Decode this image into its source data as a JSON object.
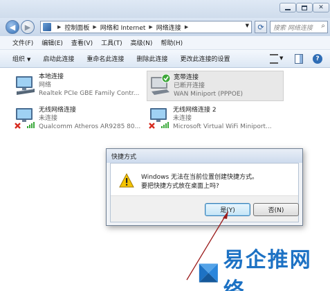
{
  "window": {
    "min_icon": "minimize-icon",
    "max_icon": "maximize-icon",
    "close_icon": "close-icon"
  },
  "navigation": {
    "back_icon": "back-arrow-icon",
    "forward_icon": "forward-arrow-icon",
    "breadcrumb": [
      "控制面板",
      "网络和 Internet",
      "网络连接"
    ],
    "refresh_icon": "refresh-icon",
    "search_placeholder": "搜索 网络连接"
  },
  "menu": [
    "文件(F)",
    "编辑(E)",
    "查看(V)",
    "工具(T)",
    "高级(N)",
    "帮助(H)"
  ],
  "toolbar": {
    "organize": "组织",
    "start": "启动此连接",
    "rename": "重命名此连接",
    "delete": "删除此连接",
    "settings": "更改此连接的设置"
  },
  "connections": [
    {
      "name": "本地连接",
      "status": "网络",
      "device": "Realtek PCIe GBE Family Contr..."
    },
    {
      "name": "宽带连接",
      "status": "已断开连接",
      "device": "WAN Miniport (PPPOE)"
    },
    {
      "name": "无线网络连接",
      "status": "未连接",
      "device": "Qualcomm Atheros AR9285 80..."
    },
    {
      "name": "无线网络连接 2",
      "status": "未连接",
      "device": "Microsoft Virtual WiFi Miniport..."
    }
  ],
  "dialog": {
    "title": "快捷方式",
    "line1": "Windows 无法在当前位置创建快捷方式。",
    "line2": "要把快捷方式放在桌面上吗?",
    "yes": "是(Y)",
    "no": "否(N)"
  },
  "watermark": {
    "text": "易企推网络"
  },
  "colors": {
    "accent": "#2f6db5",
    "annotation_arrow": "#9b1b1b",
    "watermark": "#1d72c4"
  }
}
